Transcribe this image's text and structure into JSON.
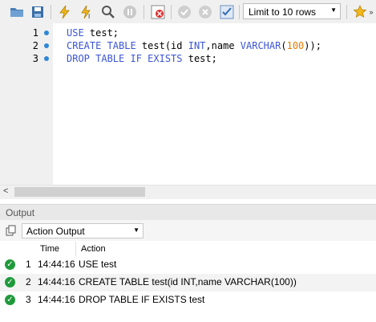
{
  "toolbar": {
    "limit_rows_value": "Limit to 10 rows",
    "icons": [
      "open-folder-icon",
      "save-icon",
      "execute-icon",
      "execute-current-icon",
      "explain-icon",
      "stop-icon",
      "toggle-error-icon",
      "commit-icon",
      "rollback-icon",
      "autocommit-icon",
      "beautify-icon"
    ]
  },
  "editor": {
    "lines": [
      {
        "number": "1",
        "tokens": [
          {
            "text": "USE",
            "kind": "kw"
          },
          {
            "text": " test;",
            "kind": "id"
          }
        ]
      },
      {
        "number": "2",
        "tokens": [
          {
            "text": "CREATE TABLE",
            "kind": "kw"
          },
          {
            "text": " test(id ",
            "kind": "id"
          },
          {
            "text": "INT",
            "kind": "kw"
          },
          {
            "text": ",name ",
            "kind": "id"
          },
          {
            "text": "VARCHAR",
            "kind": "kw"
          },
          {
            "text": "(",
            "kind": "id"
          },
          {
            "text": "100",
            "kind": "num"
          },
          {
            "text": "));",
            "kind": "id"
          }
        ]
      },
      {
        "number": "3",
        "tokens": [
          {
            "text": "DROP TABLE IF EXISTS",
            "kind": "kw"
          },
          {
            "text": " test;",
            "kind": "id"
          }
        ]
      }
    ]
  },
  "output": {
    "header": "Output",
    "selector_value": "Action Output",
    "columns": {
      "time": "Time",
      "action": "Action"
    },
    "rows": [
      {
        "num": "1",
        "time": "14:44:16",
        "action": "USE test"
      },
      {
        "num": "2",
        "time": "14:44:16",
        "action": "CREATE TABLE test(id INT,name VARCHAR(100))"
      },
      {
        "num": "3",
        "time": "14:44:16",
        "action": "DROP TABLE IF EXISTS test"
      }
    ]
  },
  "colors": {
    "keyword": "#3c55d4",
    "number": "#e07e00",
    "success": "#1f9a3b"
  }
}
